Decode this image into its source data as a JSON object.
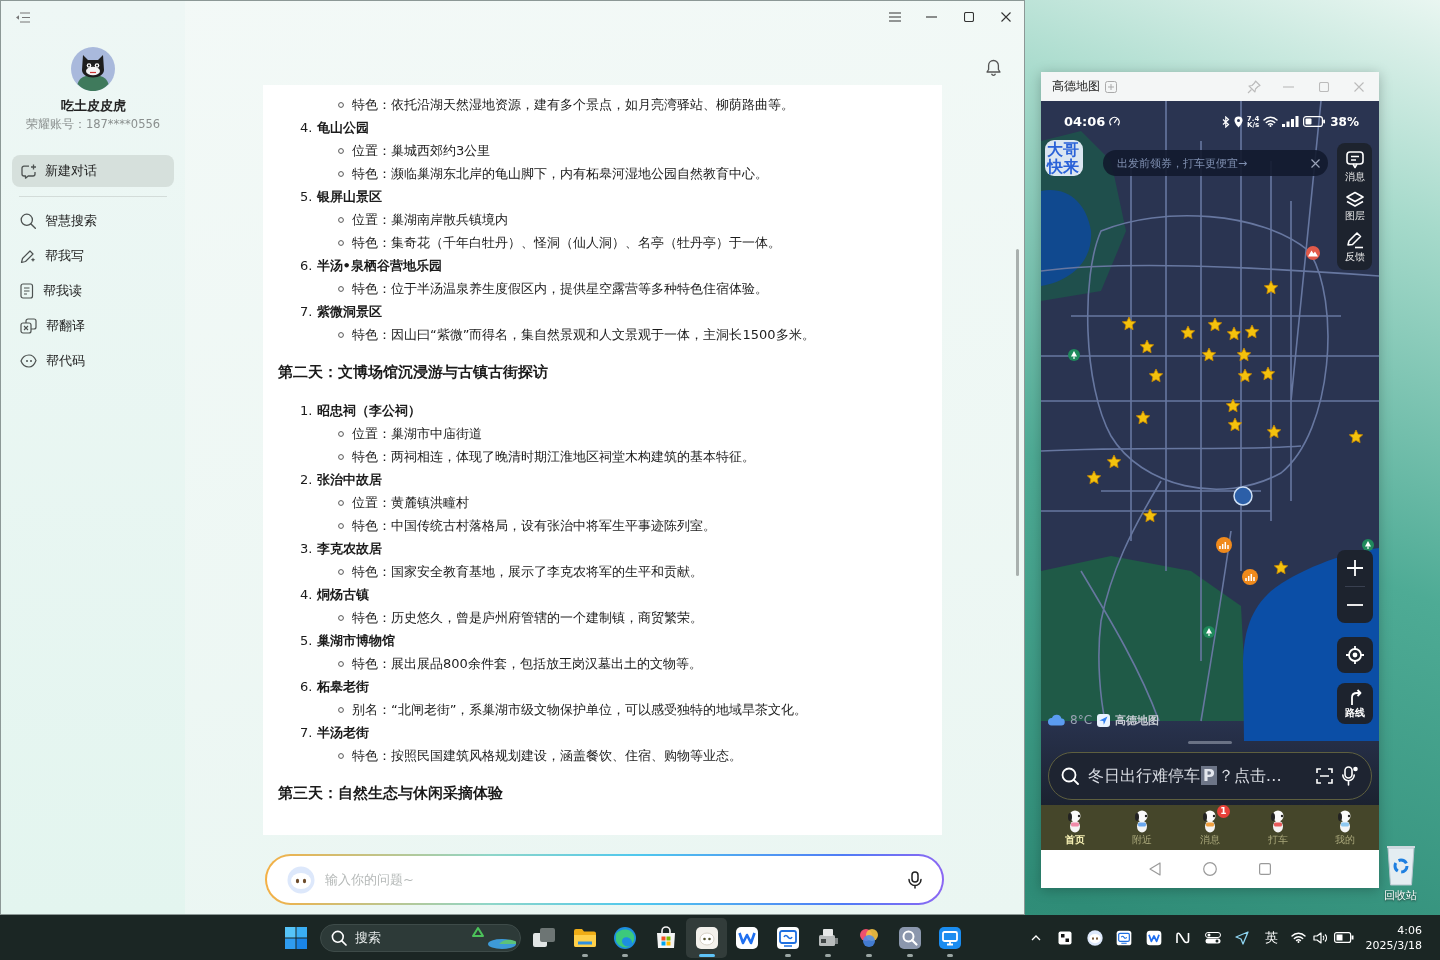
{
  "chat_window": {
    "sidebar": {
      "profile": {
        "name": "吃土皮皮虎",
        "account": "荣耀账号：187****0556"
      },
      "new_chat": "新建对话",
      "items": [
        {
          "label": "智慧搜索"
        },
        {
          "label": "帮我写"
        },
        {
          "label": "帮我读"
        },
        {
          "label": "帮翻译"
        },
        {
          "label": "帮代码"
        }
      ]
    },
    "content": {
      "blocks": [
        {
          "kind": "detail",
          "text": "特色：依托沿湖天然湿地资源，建有多个景点，如月亮湾驿站、柳荫路曲等。"
        },
        {
          "kind": "place",
          "number": "4.",
          "name": "龟山公园",
          "details": [
            "位置：巢城西郊约3公里",
            "特色：濒临巢湖东北岸的龟山脚下，内有柘皋河湿地公园自然教育中心。"
          ]
        },
        {
          "kind": "place",
          "number": "5.",
          "name": "银屏山景区",
          "details": [
            "位置：巢湖南岸散兵镇境内",
            "特色：集奇花（千年白牡丹）、怪洞（仙人洞）、名亭（牡丹亭）于一体。"
          ]
        },
        {
          "kind": "place",
          "number": "6.",
          "name": "半汤•泉栖谷营地乐园",
          "details": [
            "特色：位于半汤温泉养生度假区内，提供星空露营等多种特色住宿体验。"
          ]
        },
        {
          "kind": "place",
          "number": "7.",
          "name": "紫微洞景区",
          "details": [
            "特色：因山曰“紫微”而得名，集自然景观和人文景观于一体，主洞长1500多米。"
          ]
        },
        {
          "kind": "heading",
          "text": "第二天：文博场馆沉浸游与古镇古街探访"
        },
        {
          "kind": "place",
          "number": "1.",
          "name": "昭忠祠（李公祠）",
          "details": [
            "位置：巢湖市中庙街道",
            "特色：两祠相连，体现了晚清时期江淮地区祠堂木构建筑的基本特征。"
          ]
        },
        {
          "kind": "place",
          "number": "2.",
          "name": "张治中故居",
          "details": [
            "位置：黄麓镇洪疃村",
            "特色：中国传统古村落格局，设有张治中将军生平事迹陈列室。"
          ]
        },
        {
          "kind": "place",
          "number": "3.",
          "name": "李克农故居",
          "details": [
            "特色：国家安全教育基地，展示了李克农将军的生平和贡献。"
          ]
        },
        {
          "kind": "place",
          "number": "4.",
          "name": "烔炀古镇",
          "details": [
            "特色：历史悠久，曾是庐州府管辖的一个建制镇，商贸繁荣。"
          ]
        },
        {
          "kind": "place",
          "number": "5.",
          "name": "巢湖市博物馆",
          "details": [
            "特色：展出展品800余件套，包括放王岗汉墓出土的文物等。"
          ]
        },
        {
          "kind": "place",
          "number": "6.",
          "name": "柘皋老街",
          "details": [
            "别名：“北闸老街”，系巢湖市级文物保护单位，可以感受独特的地域旱茶文化。"
          ]
        },
        {
          "kind": "place",
          "number": "7.",
          "name": "半汤老街",
          "details": [
            "特色：按照民国建筑风格规划建设，涵盖餐饮、住宿、购物等业态。"
          ]
        },
        {
          "kind": "heading",
          "text": "第三天：自然生态与休闲采摘体验"
        }
      ]
    },
    "input": {
      "placeholder": "输入你的问题~"
    }
  },
  "map_window": {
    "title": "高德地图",
    "status_bar": {
      "time": "04:06",
      "speed_value": "7.4",
      "speed_unit": "K/s",
      "battery": "38%"
    },
    "sticker": "大哥快来",
    "banner": "出发前领券，打车更便宜→",
    "tools": [
      {
        "label": "消息"
      },
      {
        "label": "图层"
      },
      {
        "label": "反馈"
      }
    ],
    "route": "路线",
    "weather": "8°C",
    "map_brand": "高德地图",
    "search": {
      "hint": "冬日出行难停车",
      "hint_mark": "P",
      "hint_tail": "？点击…"
    },
    "tabs": [
      {
        "label": "首页",
        "selected": true
      },
      {
        "label": "附近",
        "selected": false
      },
      {
        "label": "消息",
        "selected": false,
        "badge": "1"
      },
      {
        "label": "打车",
        "selected": false
      },
      {
        "label": "我的",
        "selected": false
      }
    ]
  },
  "desktop": {
    "recycle_bin": "回收站"
  },
  "taskbar": {
    "search": {
      "placeholder": "搜索"
    },
    "apps": [
      {
        "running": false,
        "selected": false
      },
      {
        "running": true,
        "selected": false
      },
      {
        "running": true,
        "selected": false
      },
      {
        "running": false,
        "selected": false
      },
      {
        "running": true,
        "selected": true
      },
      {
        "running": false,
        "selected": false
      },
      {
        "running": true,
        "selected": false
      },
      {
        "running": true,
        "selected": false
      },
      {
        "running": true,
        "selected": false
      },
      {
        "running": true,
        "selected": false
      },
      {
        "running": true,
        "selected": false
      }
    ],
    "tray": {
      "ime": "英",
      "time": "4:06",
      "date": "2025/3/18"
    }
  }
}
